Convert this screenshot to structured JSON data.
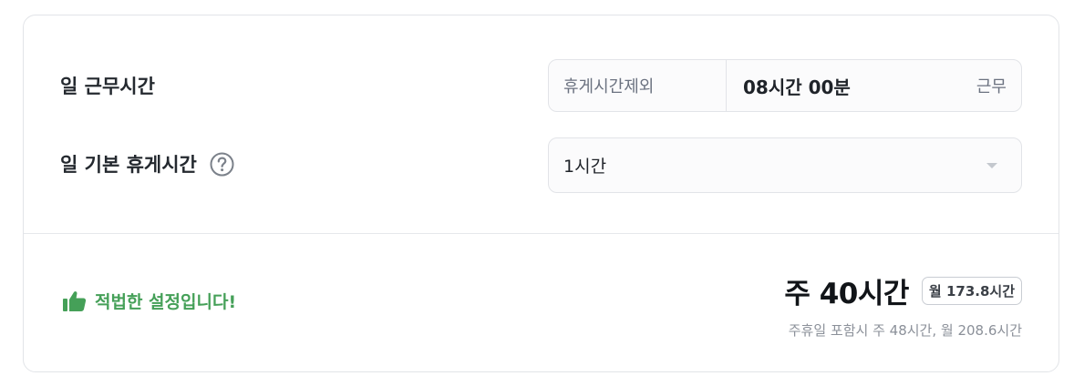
{
  "daily_work": {
    "label": "일 근무시간",
    "prefix": "휴게시간제외",
    "value": "08시간 00분",
    "suffix": "근무"
  },
  "daily_break": {
    "label": "일 기본 휴게시간",
    "help_icon": "question-circle-icon",
    "selected": "1시간"
  },
  "status": {
    "icon": "thumbs-up-icon",
    "text": "적법한 설정입니다!",
    "color": "#45a058"
  },
  "summary": {
    "weekly": "주 40시간",
    "monthly_badge": "월 173.8시간",
    "note": "주휴일 포함시 주 48시간, 월 208.6시간"
  }
}
